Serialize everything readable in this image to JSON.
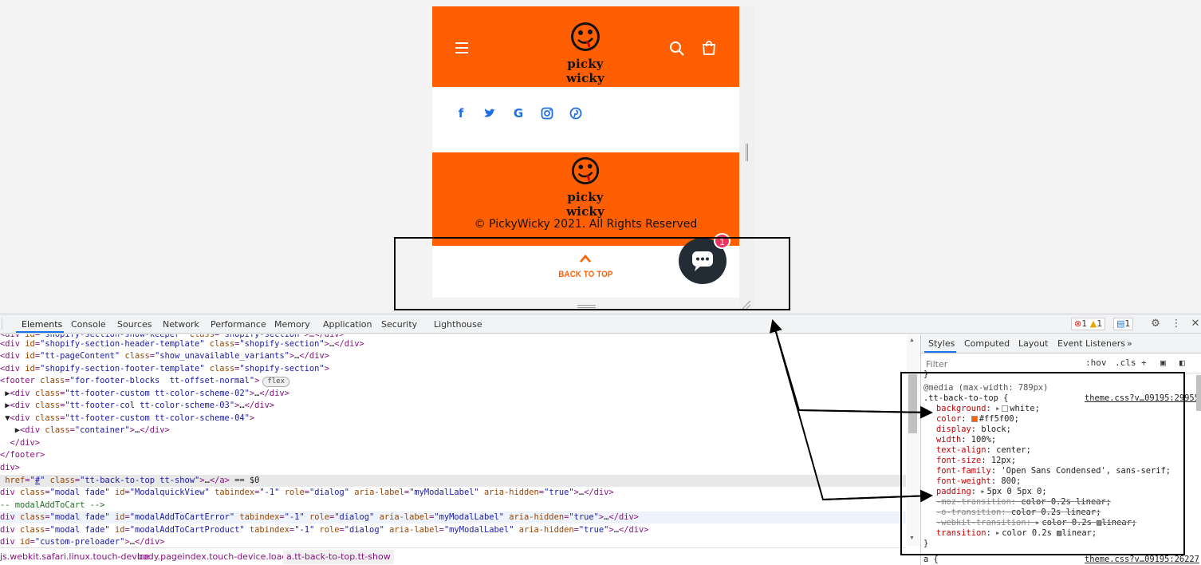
{
  "site": {
    "brand": "picky wicky",
    "copyright": "© PickyWicky 2021. All Rights Reserved",
    "back_to_top_label": "BACK TO TOP",
    "chat_badge_count": "1",
    "social_icons": [
      "facebook-icon",
      "twitter-icon",
      "google-icon",
      "instagram-icon",
      "pinterest-icon"
    ],
    "brand_color": "#ff5f00",
    "social_color": "#1f6fe6",
    "chat_color": "#232b35",
    "badge_color": "#ec3461"
  },
  "devtools": {
    "tabs": [
      "Elements",
      "Console",
      "Sources",
      "Network",
      "Performance",
      "Memory",
      "Application",
      "Security",
      "Lighthouse"
    ],
    "active_tab": "Elements",
    "errors": "1",
    "warnings": "1",
    "messages": "1",
    "dom_lines": [
      {
        "html": "<span class='tag'>&lt;div</span> <span class='an'>id</span>=<span class='av'>\"shopify-section-header-template\"</span> <span class='an'>class</span>=<span class='av'>\"shopify-section\"</span><span class='tag'>&gt;</span><span class='tx'>…</span><span class='tag'>&lt;/div&gt;</span>"
      },
      {
        "html": "<span class='tag'>&lt;div</span> <span class='an'>id</span>=<span class='av'>\"tt-pageContent\"</span> <span class='an'>class</span>=<span class='av'>\"show_unavailable_variants\"</span><span class='tag'>&gt;</span><span class='tx'>…</span><span class='tag'>&lt;/div&gt;</span>"
      },
      {
        "html": "<span class='tag'>&lt;div</span> <span class='an'>id</span>=<span class='av'>\"shopify-section-footer-template\"</span> <span class='an'>class</span>=<span class='av'>\"shopify-section\"</span><span class='tag'>&gt;</span>"
      },
      {
        "html": "<span class='tag'>&lt;footer</span> <span class='an'>class</span>=<span class='av'>\"for-footer-blocks  tt-offset-normal\"</span><span class='tag'>&gt;</span><span class='flex-badge'>flex</span>"
      },
      {
        "html": " <span class='tx'>▶</span><span class='tag'>&lt;div</span> <span class='an'>class</span>=<span class='av'>\"tt-footer-custom tt-color-scheme-02\"</span><span class='tag'>&gt;</span><span class='tx'>…</span><span class='tag'>&lt;/div&gt;</span>"
      },
      {
        "html": " <span class='tx'>▶</span><span class='tag'>&lt;div</span> <span class='an'>class</span>=<span class='av'>\"tt-footer-col tt-color-scheme-03\"</span><span class='tag'>&gt;</span><span class='tx'>…</span><span class='tag'>&lt;/div&gt;</span>"
      },
      {
        "html": " <span class='tx'>▼</span><span class='tag'>&lt;div</span> <span class='an'>class</span>=<span class='av'>\"tt-footer-custom tt-color-scheme-04\"</span><span class='tag'>&gt;</span>"
      },
      {
        "html": "   <span class='tx'>▶</span><span class='tag'>&lt;div</span> <span class='an'>class</span>=<span class='av'>\"container\"</span><span class='tag'>&gt;</span><span class='tx'>…</span><span class='tag'>&lt;/div&gt;</span>"
      },
      {
        "html": "  <span class='tag'>&lt;/div&gt;</span>"
      },
      {
        "html": "<span class='tag'>&lt;/footer&gt;</span>"
      },
      {
        "html": "<span class='tag'>div&gt;</span>"
      },
      {
        "html": " <span class='an'>href</span>=<span class='av'>\"<u>#</u>\"</span> <span class='an'>class</span>=<span class='av'>\"tt-back-to-top tt-show\"</span><span class='tag'>&gt;</span><span class='tx'>…</span><span class='tag'>&lt;/a&gt;</span> <span class='tx'>== $0</span>"
      },
      {
        "html": "<span class='tag'>div</span> <span class='an'>class</span>=<span class='av'>\"modal fade\"</span> <span class='an'>id</span>=<span class='av'>\"ModalquickView\"</span> <span class='an'>tabindex</span>=<span class='av'>\"-1\"</span> <span class='an'>role</span>=<span class='av'>\"dialog\"</span> <span class='an'>aria-label</span>=<span class='av'>\"myModalLabel\"</span> <span class='an'>aria-hidden</span>=<span class='av'>\"true\"</span><span class='tag'>&gt;</span><span class='tx'>…</span><span class='tag'>&lt;/div&gt;</span>"
      },
      {
        "html": "<span class='cm'>-- modalAddToCart --&gt;</span>"
      },
      {
        "html": "<span class='tag'>div</span> <span class='an'>class</span>=<span class='av'>\"modal fade\"</span> <span class='an'>id</span>=<span class='av'>\"modalAddToCartError\"</span> <span class='an'>tabindex</span>=<span class='av'>\"-1\"</span> <span class='an'>role</span>=<span class='av'>\"dialog\"</span> <span class='an'>aria-label</span>=<span class='av'>\"myModalLabel\"</span> <span class='an'>aria-hidden</span>=<span class='av'>\"true\"</span><span class='tag'>&gt;</span><span class='tx'>…</span><span class='tag'>&lt;/div&gt;</span>"
      },
      {
        "html": "<span class='tag'>div</span> <span class='an'>class</span>=<span class='av'>\"modal fade\"</span> <span class='an'>id</span>=<span class='av'>\"modalAddToCartProduct\"</span> <span class='an'>tabindex</span>=<span class='av'>\"-1\"</span> <span class='an'>role</span>=<span class='av'>\"dialog\"</span> <span class='an'>aria-label</span>=<span class='av'>\"myModalLabel\"</span> <span class='an'>aria-hidden</span>=<span class='av'>\"true\"</span><span class='tag'>&gt;</span><span class='tx'>…</span><span class='tag'>&lt;/div&gt;</span>"
      },
      {
        "html": "<span class='tag'>div</span> <span class='an'>id</span>=<span class='av'>\"custom-preloader\"</span><span class='tag'>&gt;</span><span class='tx'>…</span><span class='tag'>&lt;/div&gt;</span>"
      }
    ],
    "breadcrumbs": [
      "js.webkit.safari.linux.touch-device",
      "body.pageindex.touch-device.loaded",
      "a.tt-back-to-top.tt-show"
    ],
    "styles": {
      "tabs": [
        "Styles",
        "Computed",
        "Layout",
        "Event Listeners"
      ],
      "filter_placeholder": "Filter",
      "hov": ":hov",
      "cls": ".cls",
      "media": "@media (max-width: 789px)",
      "selector": ".tt-back-to-top {",
      "source": "theme.css?v…09195:29955",
      "source2": "theme.css?v…09195:26227",
      "rules": [
        {
          "prop": "background",
          "val": "white;",
          "swatch": "#ffffff",
          "tri": true
        },
        {
          "prop": "color",
          "val": "#ff5f00;",
          "swatch": "#ff5f00"
        },
        {
          "prop": "display",
          "val": "block;"
        },
        {
          "prop": "width",
          "val": "100%;"
        },
        {
          "prop": "text-align",
          "val": "center;"
        },
        {
          "prop": "font-size",
          "val": "12px;"
        },
        {
          "prop": "font-family",
          "val": "'Open Sans Condensed', sans-serif;"
        },
        {
          "prop": "font-weight",
          "val": "800;"
        },
        {
          "prop": "padding",
          "val": "5px 0 5px 0;",
          "tri": true
        },
        {
          "prop": "-moz-transition",
          "val": "color 0.2s linear;",
          "struck": true
        },
        {
          "prop": "-o-transition",
          "val": "color 0.2s linear;",
          "struck": true
        },
        {
          "prop": "-webkit-transition",
          "val": "color 0.2s ▨linear;",
          "struck": true,
          "tri": true
        },
        {
          "prop": "transition",
          "val": "color 0.2s ▨linear;",
          "tri": true
        }
      ],
      "close_brace": "}"
    }
  }
}
